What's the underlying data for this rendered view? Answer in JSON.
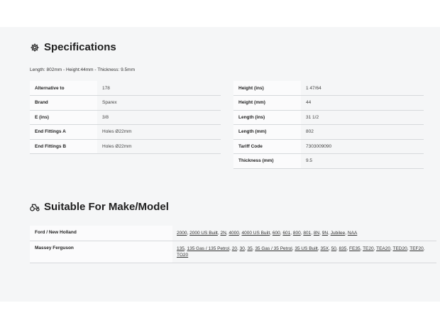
{
  "specifications": {
    "title": "Specifications",
    "icon": "gear-icon",
    "dimensions_text": "Length: 802mm - Height:44mm - Thickness: 9.5mm",
    "left_rows": [
      {
        "label": "Alternative to",
        "value": "178"
      },
      {
        "label": "Brand",
        "value": "Sparex"
      },
      {
        "label": "E (ins)",
        "value": "3/8"
      },
      {
        "label": "End Fittings A",
        "value": "Holes Ø22mm"
      },
      {
        "label": "End Fittings B",
        "value": "Holes Ø22mm"
      }
    ],
    "right_rows": [
      {
        "label": "Height (ins)",
        "value": "1 47/64"
      },
      {
        "label": "Height (mm)",
        "value": "44"
      },
      {
        "label": "Length (ins)",
        "value": "31 1/2"
      },
      {
        "label": "Length (mm)",
        "value": "802"
      },
      {
        "label": "Tariff Code",
        "value": "7303009090"
      },
      {
        "label": "Thickness (mm)",
        "value": "9.5"
      }
    ]
  },
  "suitable": {
    "title": "Suitable For Make/Model",
    "icon": "tractor-icon",
    "rows": [
      {
        "make": "Ford / New Holland",
        "models": [
          "2000",
          "2000 US Built",
          "2N",
          "4000",
          "4000 US Built",
          "600",
          "601",
          "800",
          "801",
          "8N",
          "9N",
          "Jubilee",
          "NAA"
        ]
      },
      {
        "make": "Massey Ferguson",
        "models": [
          "135",
          "135 Gas / 135 Petrol",
          "20",
          "30",
          "35",
          "35 Gas / 35 Petrol",
          "35 US Built",
          "35X",
          "50",
          "835",
          "FE35",
          "TE20",
          "TEA20",
          "TED20",
          "TEF20",
          "TO20"
        ]
      }
    ]
  }
}
